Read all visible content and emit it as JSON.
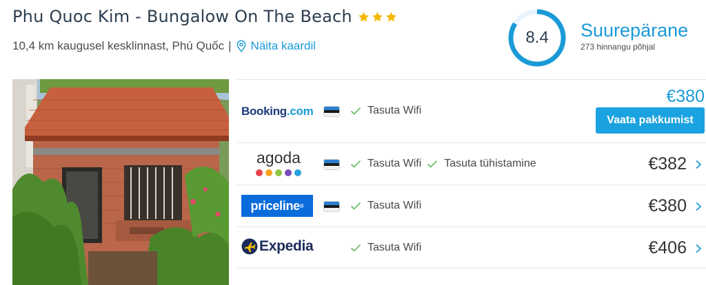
{
  "hotel": {
    "name": "Phu Quoc Kim - Bungalow On The Beach",
    "stars": 3,
    "distance_text": "10,4 km kaugusel kesklinnast, Phú Quốc",
    "separator": "|",
    "map_link": "Näita kaardil"
  },
  "rating": {
    "score": "8.4",
    "fraction": 0.84,
    "label": "Suurepärane",
    "count_text": "273 hinnangu põhjal",
    "color": "#1a9ad6"
  },
  "deals": [
    {
      "provider": "Booking.com",
      "logo_main": "Booking",
      "logo_suffix": ".com",
      "amenities": [
        "Tasuta Wifi"
      ],
      "price": "€380",
      "button": "Vaata pakkumist",
      "featured": true,
      "flag": "estonia"
    },
    {
      "provider": "agoda",
      "logo_main": "agoda",
      "amenities": [
        "Tasuta Wifi",
        "Tasuta tühistamine"
      ],
      "price": "€382",
      "flag": "estonia"
    },
    {
      "provider": "priceline",
      "logo_main": "priceline",
      "logo_suffix": "®",
      "amenities": [
        "Tasuta Wifi"
      ],
      "price": "€380",
      "flag": "estonia"
    },
    {
      "provider": "Expedia",
      "logo_main": "Expedia",
      "amenities": [
        "Tasuta Wifi"
      ],
      "price": "€406",
      "flag": null
    }
  ],
  "icons": {
    "star": "star-icon",
    "pin": "map-pin-icon",
    "check": "check-icon",
    "chevron": "chevron-right-icon"
  },
  "colors": {
    "accent": "#1a9ad6",
    "star": "#f5b800",
    "check": "#5cb85c",
    "button": "#1ba2e0"
  }
}
